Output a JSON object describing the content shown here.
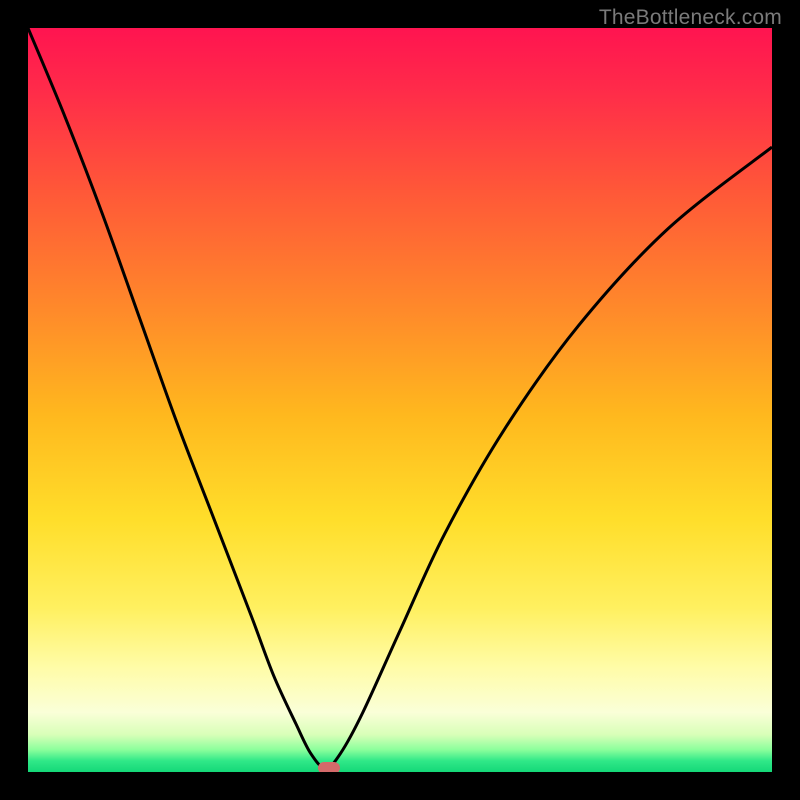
{
  "watermark": {
    "text": "TheBottleneck.com"
  },
  "marker": {
    "color": "#d46a6a",
    "x_frac": 0.405,
    "y_frac": 0.995
  },
  "chart_data": {
    "type": "line",
    "title": "",
    "xlabel": "",
    "ylabel": "",
    "xlim": [
      0,
      1
    ],
    "ylim": [
      0,
      1
    ],
    "note": "Units are fractions of the plot area. x runs left→right, y runs top→bottom (y=0 at top). The curve is a V-shaped bottleneck profile touching the bottom near x≈0.40.",
    "series": [
      {
        "name": "bottleneck-curve",
        "x": [
          0.0,
          0.05,
          0.1,
          0.15,
          0.2,
          0.25,
          0.3,
          0.33,
          0.36,
          0.38,
          0.4,
          0.42,
          0.45,
          0.5,
          0.56,
          0.64,
          0.74,
          0.86,
          1.0
        ],
        "y": [
          0.0,
          0.12,
          0.25,
          0.39,
          0.53,
          0.66,
          0.79,
          0.87,
          0.935,
          0.975,
          0.995,
          0.975,
          0.92,
          0.81,
          0.68,
          0.54,
          0.4,
          0.27,
          0.16
        ],
        "color": "#000000",
        "width": 3
      }
    ]
  }
}
